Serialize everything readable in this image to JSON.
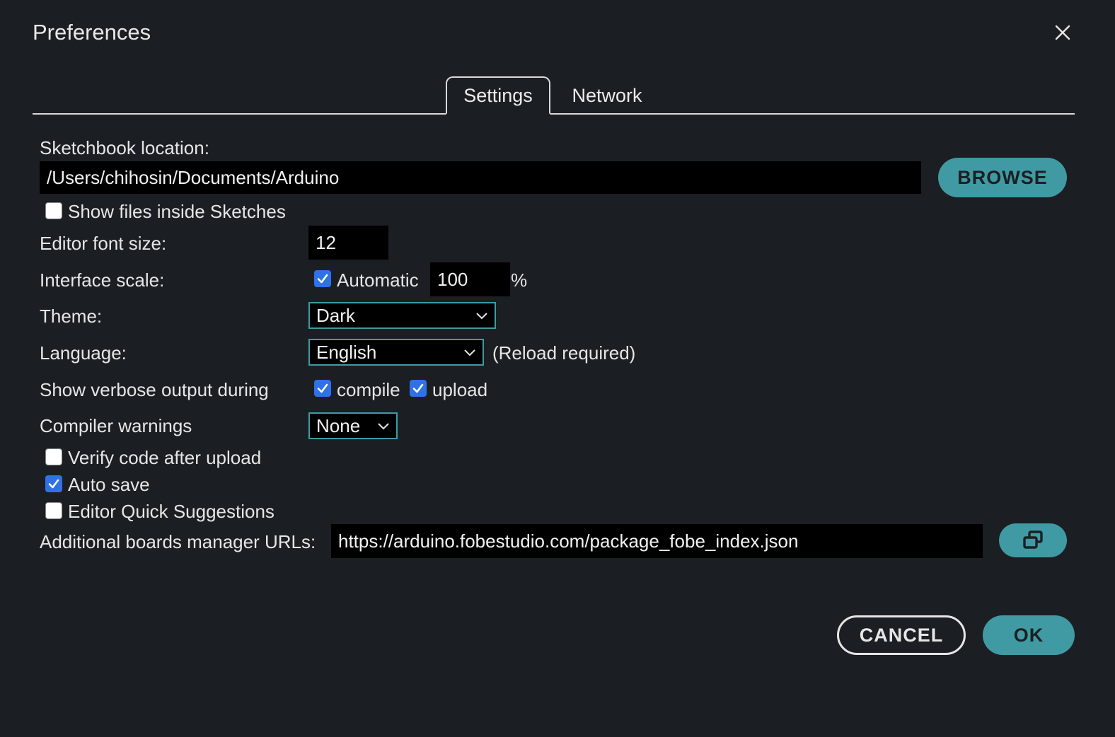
{
  "dialog": {
    "title": "Preferences"
  },
  "tabs": [
    {
      "label": "Settings",
      "active": true
    },
    {
      "label": "Network",
      "active": false
    }
  ],
  "sketchbook": {
    "label": "Sketchbook location:",
    "value": "/Users/chihosin/Documents/Arduino",
    "browse_label": "BROWSE"
  },
  "show_files": {
    "label": "Show files inside Sketches",
    "checked": false
  },
  "font_size": {
    "label": "Editor font size:",
    "value": "12"
  },
  "interface_scale": {
    "label": "Interface scale:",
    "automatic_label": "Automatic",
    "automatic_checked": true,
    "value": "100",
    "unit": "%"
  },
  "theme": {
    "label": "Theme:",
    "selected": "Dark"
  },
  "language": {
    "label": "Language:",
    "selected": "English",
    "note": "(Reload required)"
  },
  "verbose": {
    "label": "Show verbose output during",
    "compile_label": "compile",
    "compile_checked": true,
    "upload_label": "upload",
    "upload_checked": true
  },
  "compiler_warnings": {
    "label": "Compiler warnings",
    "selected": "None"
  },
  "verify_code": {
    "label": "Verify code after upload",
    "checked": false
  },
  "auto_save": {
    "label": "Auto save",
    "checked": true
  },
  "quick_suggestions": {
    "label": "Editor Quick Suggestions",
    "checked": false
  },
  "boards_urls": {
    "label": "Additional boards manager URLs:",
    "value": "https://arduino.fobestudio.com/package_fobe_index.json"
  },
  "footer": {
    "cancel_label": "CANCEL",
    "ok_label": "OK"
  },
  "colors": {
    "background": "#1b1f23",
    "accent": "#3f9aa3",
    "checkbox_on": "#2f72e8"
  }
}
